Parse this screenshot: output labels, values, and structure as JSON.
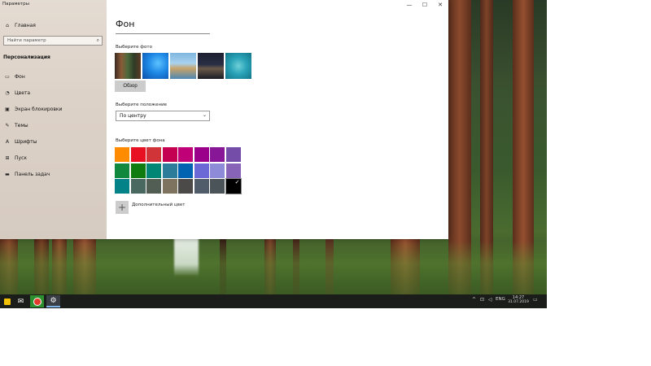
{
  "window": {
    "title": "Параметры",
    "controls": {
      "minimize": "—",
      "maximize": "☐",
      "close": "✕"
    }
  },
  "sidebar": {
    "home_label": "Главная",
    "search_placeholder": "Найти параметр",
    "section_title": "Персонализация",
    "items": [
      {
        "label": "Фон",
        "icon": "picture-icon"
      },
      {
        "label": "Цвета",
        "icon": "palette-icon"
      },
      {
        "label": "Экран блокировки",
        "icon": "lock-screen-icon"
      },
      {
        "label": "Темы",
        "icon": "brush-icon"
      },
      {
        "label": "Шрифты",
        "icon": "font-icon"
      },
      {
        "label": "Пуск",
        "icon": "start-icon"
      },
      {
        "label": "Панель задач",
        "icon": "taskbar-icon"
      }
    ]
  },
  "main": {
    "title": "Фон",
    "choose_photo_label": "Выберите фото",
    "browse_label": "Обзор",
    "position_label": "Выберите положение",
    "position_value": "По центру",
    "bg_color_label": "Выберите цвет фона",
    "custom_color_label": "Дополнительный цвет"
  },
  "colors": [
    [
      "#ff8c00",
      "#e81123",
      "#d13438",
      "#c30052",
      "#bf0077",
      "#9a0089",
      "#881798",
      "#744da9"
    ],
    [
      "#10893e",
      "#107c10",
      "#018574",
      "#2d7d9a",
      "#0063b1",
      "#6b69d6",
      "#8e8cd8",
      "#8764b8"
    ],
    [
      "#038387",
      "#486860",
      "#525e54",
      "#7e735f",
      "#4c4a48",
      "#515c6b",
      "#4a5459",
      "#000000"
    ]
  ],
  "selected_color": "#000000",
  "taskbar": {
    "lang": "ENG",
    "time": "14:27",
    "date": "31.07.2019"
  }
}
